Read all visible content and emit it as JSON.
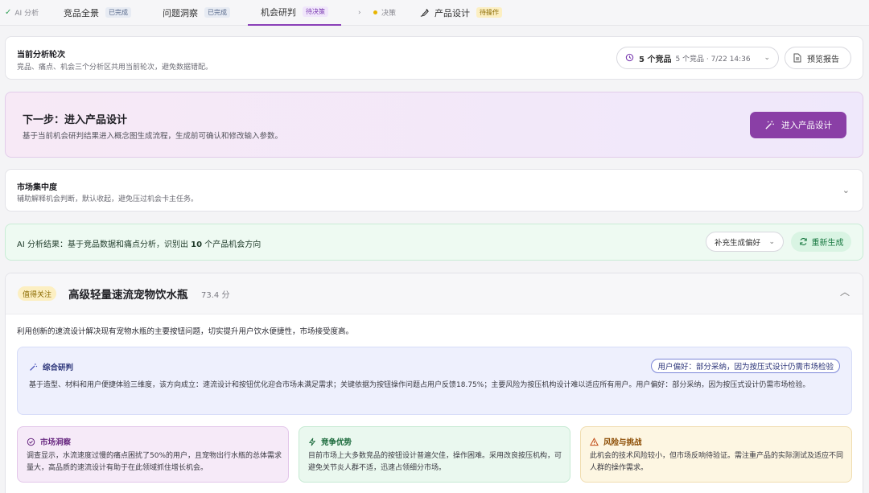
{
  "steps": [
    {
      "label": "AI 分析",
      "state": "done-small"
    },
    {
      "label": "竞品全景",
      "badge": "已完成"
    },
    {
      "label": "问题洞察",
      "badge": "已完成"
    },
    {
      "label": "机会研判",
      "badge": "待决策"
    },
    {
      "label": "决策"
    },
    {
      "label": "产品设计",
      "badge": "待操作"
    }
  ],
  "round": {
    "title": "当前分析轮次",
    "desc": "竞品、痛点、机会三个分析区共用当前轮次，避免数据错配。",
    "selector_main": "5 个竞品",
    "selector_sub": "5 个竞品 · 7/22 14:36",
    "preview_label": "预览报告"
  },
  "next": {
    "title": "下一步：进入产品设计",
    "desc": "基于当前机会研判结果进入概念图生成流程，生成前可确认和修改输入参数。",
    "button": "进入产品设计"
  },
  "market": {
    "title": "市场集中度",
    "desc": "辅助解释机会判断，默认收起，避免压过机会卡主任务。"
  },
  "ai_result": {
    "prefix": "AI 分析结果：基于竞品数据和痛点分析，识别出 ",
    "count": "10",
    "suffix": " 个产品机会方向",
    "pref_button": "补充生成偏好",
    "regen_button": "重新生成"
  },
  "opportunity": {
    "tag": "值得关注",
    "title": "高级轻量速流宠物饮水瓶",
    "score": "73.4 分",
    "summary": "利用创新的速流设计解决现有宠物水瓶的主要按钮问题，切实提升用户饮水便捷性，市场接受度高。",
    "synthesis": {
      "title": "综合研判",
      "pref": "用户偏好：部分采纳，因为按压式设计仍需市场检验",
      "body": "基于造型、材料和用户便捷体验三维度，该方向成立：速流设计和按钮优化迎合市场未满足需求；关键依据为按钮操作问题占用户反馈18.75%；主要风险为按压机构设计难以适应所有用户。用户偏好：部分采纳，因为按压式设计仍需市场检验。"
    },
    "insights": [
      {
        "title": "市场洞察",
        "body": "调查显示，水流速度过慢的痛点困扰了50%的用户，且宠物出行水瓶的总体需求量大，高品质的速流设计有助于在此领域抓住增长机会。"
      },
      {
        "title": "竞争优势",
        "body": "目前市场上大多数竞品的按钮设计普遍欠佳，操作困难。采用改良按压机构，可避免关节炎人群不适，迅速占领细分市场。"
      },
      {
        "title": "风险与挑战",
        "body": "此机会的技术风险较小，但市场反响待验证。需注重产品的实际测试及适应不同人群的操作需求。"
      }
    ]
  },
  "colors": {
    "accent": "#8a3fa6",
    "green": "#1b7a43",
    "blue": "#3b46b5"
  }
}
